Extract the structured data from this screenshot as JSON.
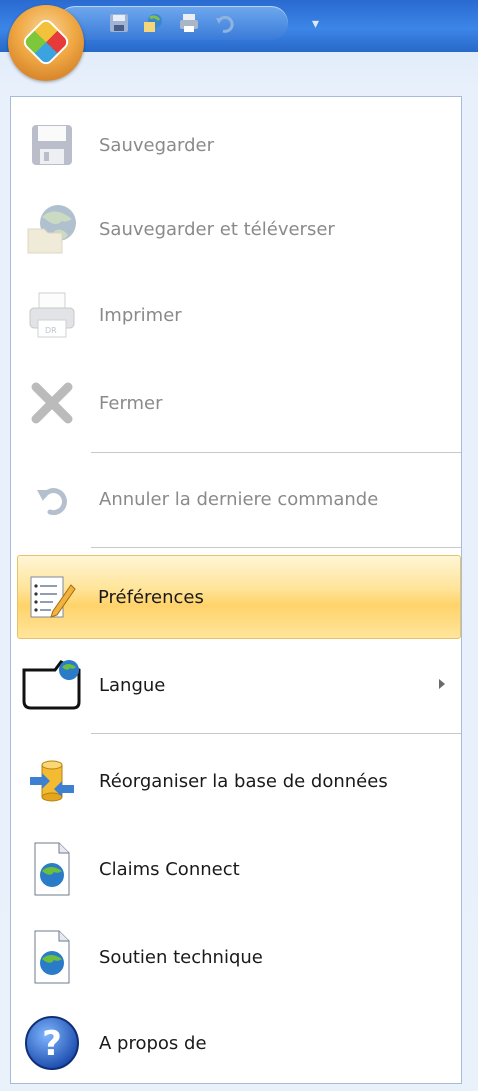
{
  "menu": {
    "items": [
      {
        "label": "Sauvegarder",
        "icon": "save-icon",
        "disabled": true
      },
      {
        "label": "Sauvegarder et téléverser",
        "icon": "save-upload-icon",
        "disabled": true
      },
      {
        "label": "Imprimer",
        "icon": "printer-icon",
        "disabled": true
      },
      {
        "label": "Fermer",
        "icon": "close-icon",
        "disabled": true
      },
      {
        "label": "Annuler la derniere commande",
        "icon": "undo-icon",
        "disabled": true
      },
      {
        "label": "Préférences",
        "icon": "preferences-icon",
        "highlighted": true
      },
      {
        "label": "Langue",
        "icon": "language-icon",
        "has_submenu": true
      },
      {
        "label": "Réorganiser la base de données",
        "icon": "database-reorganize-icon"
      },
      {
        "label": "Claims Connect",
        "icon": "web-document-icon"
      },
      {
        "label": "Soutien technique",
        "icon": "web-document-icon"
      },
      {
        "label": "A propos de",
        "icon": "help-icon"
      }
    ]
  },
  "colors": {
    "titlebar": "#3c86e8",
    "highlight": "#ffd36a",
    "disabled_text": "#8a8a8a"
  }
}
